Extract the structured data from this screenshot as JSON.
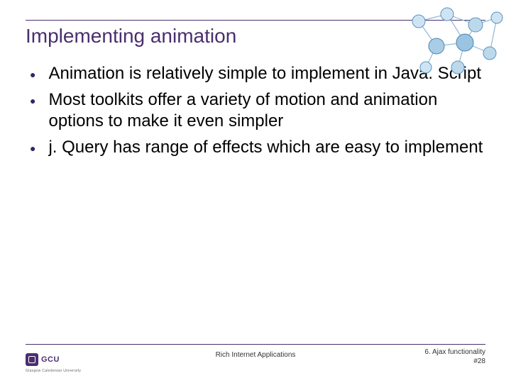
{
  "title": "Implementing animation",
  "bullets": [
    "Animation is relatively simple to implement in Java. Script",
    "Most toolkits offer a variety of motion and animation options to make it even simpler",
    "j. Query has range of effects which are easy to implement"
  ],
  "footer": {
    "center": "Rich Internet Applications",
    "right_line1": "6. Ajax functionality",
    "right_line2": "#28"
  },
  "logo": {
    "text": "GCU",
    "subtext": "Glasgow Caledonian University"
  }
}
